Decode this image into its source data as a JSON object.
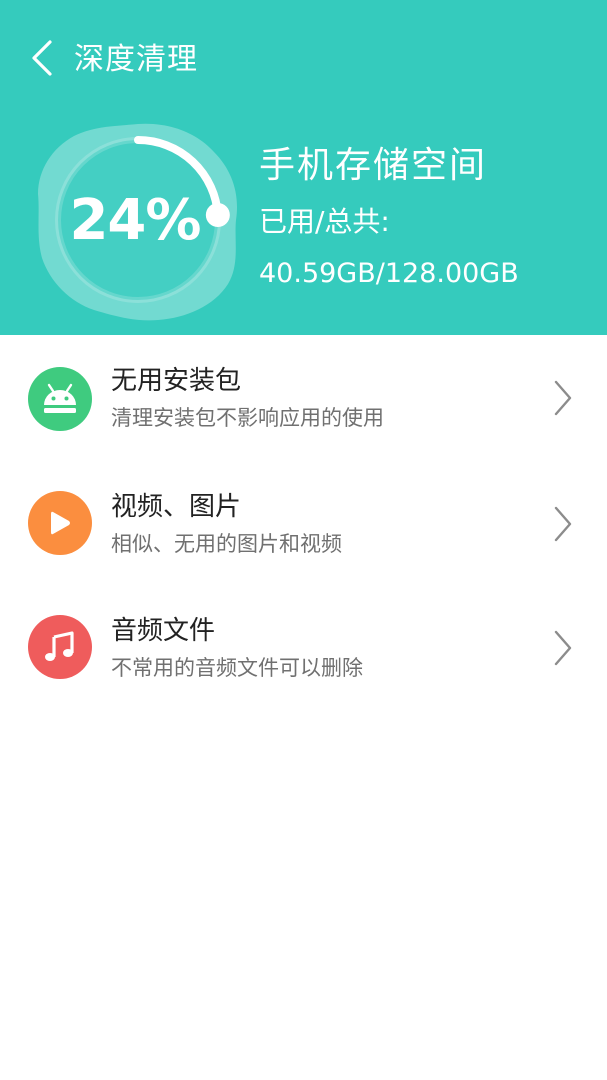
{
  "header": {
    "title": "深度清理",
    "back_icon": "chevron-left-icon",
    "background_color": "#35cbbd"
  },
  "storage": {
    "percent_text": "24%",
    "percent_value": 0.24,
    "title": "手机存储空间",
    "used_label": "已用/总共:",
    "values": "40.59GB/128.00GB"
  },
  "items": [
    {
      "title": "无用安装包",
      "subtitle": "清理安装包不影响应用的使用",
      "icon": "android-icon",
      "color": "#3fcb7f"
    },
    {
      "title": "视频、图片",
      "subtitle": "相似、无用的图片和视频",
      "icon": "play-icon",
      "color": "#fb8e3f"
    },
    {
      "title": "音频文件",
      "subtitle": "不常用的音频文件可以删除",
      "icon": "music-note-icon",
      "color": "#ef5c5c"
    }
  ]
}
